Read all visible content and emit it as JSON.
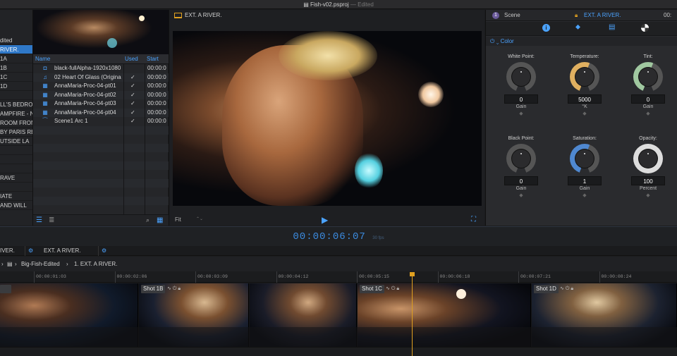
{
  "window": {
    "title": "Fish-v02.psproj",
    "title_sep": "—",
    "status": "Edited"
  },
  "scenes": {
    "items": [
      "dited",
      "RIVER.",
      "1A",
      "1B",
      "1C",
      "1D",
      "",
      "LL'S BEDRO",
      "AMPFIRE - N",
      "ROOM FRONT",
      "BY PARIS RE",
      "UTSIDE LA",
      "",
      "",
      "",
      "RAVE",
      "",
      "IATE",
      "AND WILL"
    ],
    "selected_index": 1
  },
  "media": {
    "columns": {
      "name": "Name",
      "used": "Used",
      "start": "Start"
    },
    "rows": [
      {
        "icon": "camera-icon",
        "glyph": "◘",
        "name": "black-fullAlpha-1920x1080",
        "used": "",
        "start": "00:00:0"
      },
      {
        "icon": "music-note-icon",
        "glyph": "♫",
        "name": "02 Heart Of Glass (Origina",
        "used": "✓",
        "start": "00:00:0"
      },
      {
        "icon": "film-icon",
        "glyph": "▦",
        "name": "AnnaMaria-Proc-04-pt01",
        "used": "✓",
        "start": "00:00:0"
      },
      {
        "icon": "film-icon",
        "glyph": "▦",
        "name": "AnnaMaria-Proc-04-pt02",
        "used": "✓",
        "start": "00:00:0"
      },
      {
        "icon": "film-icon",
        "glyph": "▦",
        "name": "AnnaMaria-Proc-04-pt03",
        "used": "✓",
        "start": "00:00:0"
      },
      {
        "icon": "film-icon",
        "glyph": "▦",
        "name": "AnnaMaria-Proc-04-pt04",
        "used": "✓",
        "start": "00:00:0"
      },
      {
        "icon": "arc-icon",
        "glyph": "⁀",
        "name": "Scene1 Arc 1",
        "used": "✓",
        "start": "00:00:0"
      }
    ]
  },
  "viewer": {
    "title": "EXT. A RIVER.",
    "fit": "Fit",
    "fit_arrows": "⌃⌄"
  },
  "inspector": {
    "scene_badge": "1",
    "scene_label": "Scene",
    "scene_name": "EXT. A RIVER.",
    "timecode_partial": "00:",
    "section": "Color",
    "params": [
      {
        "label": "White Point:",
        "value": "0",
        "unit": "Gain",
        "knob_color": "#888888",
        "knob_fraction": 0
      },
      {
        "label": "Temperature:",
        "value": "5000",
        "unit": "°K",
        "knob_color": "#e0b060",
        "knob_fraction": 0.5
      },
      {
        "label": "Tint:",
        "value": "0",
        "unit": "Gain",
        "knob_color": "#a0c8a0",
        "knob_fraction": 0.5
      },
      {
        "label": "Black Point:",
        "value": "0",
        "unit": "Gain",
        "knob_color": "#888888",
        "knob_fraction": 0
      },
      {
        "label": "Saturation:",
        "value": "1",
        "unit": "Gain",
        "knob_color": "#4f88d0",
        "knob_fraction": 0.5
      },
      {
        "label": "Opacity:",
        "value": "100",
        "unit": "Percent",
        "knob_color": "#dddddd",
        "knob_fraction": 1
      }
    ]
  },
  "transport": {
    "timecode": "00:00:06:07",
    "fps": "30 fps"
  },
  "timeline": {
    "tabs": [
      "IVER.",
      "EXT. A RIVER."
    ],
    "breadcrumb": [
      "Big-Fish-Edited",
      "1. EXT. A RIVER."
    ],
    "ruler": [
      "00:00:01:03",
      "00:00:02:06",
      "00:00:03:09",
      "00:00:04:12",
      "00:00:05:15",
      "00:00:06:18",
      "00:00:07:21",
      "00:00:08:24"
    ],
    "shots": [
      "Shot 1B",
      "Shot 1C",
      "Shot 1D"
    ]
  },
  "colors": {
    "accent": "#4ba3ff",
    "selection": "#2f78c8",
    "playhead": "#e0a020",
    "timecode": "#3b8be0"
  }
}
